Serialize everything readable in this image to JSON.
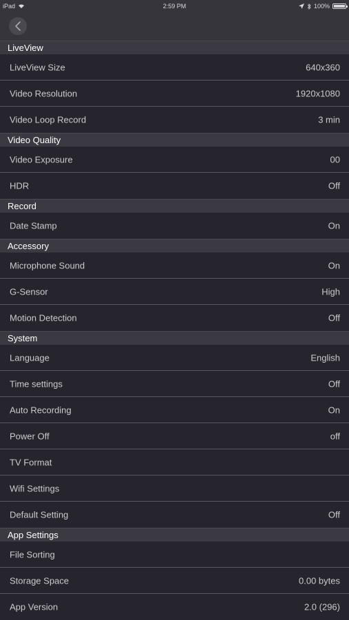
{
  "status_bar": {
    "device": "iPad",
    "time": "2:59 PM",
    "battery_text": "100%",
    "battery_level": 1.0
  },
  "nav": {
    "back_icon": "chevron-left-icon"
  },
  "sections": [
    {
      "title": "LiveView",
      "rows": [
        {
          "label": "LiveView Size",
          "value": "640x360"
        },
        {
          "label": "Video Resolution",
          "value": "1920x1080"
        },
        {
          "label": "Video Loop Record",
          "value": "3 min"
        }
      ]
    },
    {
      "title": "Video Quality",
      "rows": [
        {
          "label": "Video Exposure",
          "value": "00"
        },
        {
          "label": "HDR",
          "value": "Off"
        }
      ]
    },
    {
      "title": "Record",
      "rows": [
        {
          "label": "Date Stamp",
          "value": "On"
        }
      ]
    },
    {
      "title": "Accessory",
      "rows": [
        {
          "label": "Microphone Sound",
          "value": "On"
        },
        {
          "label": "G-Sensor",
          "value": "High"
        },
        {
          "label": "Motion Detection",
          "value": "Off"
        }
      ]
    },
    {
      "title": "System",
      "rows": [
        {
          "label": "Language",
          "value": "English"
        },
        {
          "label": "Time settings",
          "value": "Off"
        },
        {
          "label": "Auto Recording",
          "value": "On"
        },
        {
          "label": "Power Off",
          "value": "off"
        },
        {
          "label": "TV Format",
          "value": ""
        },
        {
          "label": "Wifi Settings",
          "value": ""
        },
        {
          "label": "Default Setting",
          "value": "Off"
        }
      ]
    },
    {
      "title": "App Settings",
      "rows": [
        {
          "label": "File Sorting",
          "value": ""
        },
        {
          "label": "Storage Space",
          "value": "0.00 bytes"
        },
        {
          "label": "App Version",
          "value": "2.0 (296)"
        }
      ]
    }
  ]
}
